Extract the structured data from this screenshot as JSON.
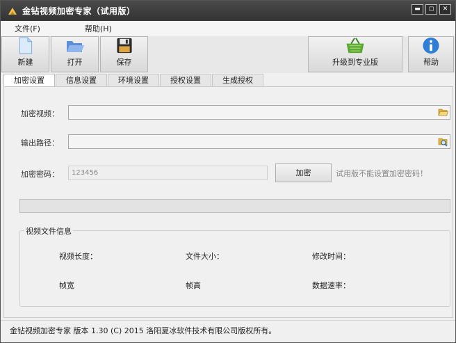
{
  "window": {
    "title": "金钻视频加密专家（试用版）",
    "controls": {
      "minimize": "▬",
      "maximize": "◻",
      "close": "✕"
    }
  },
  "menu": [
    {
      "label": "文件(F)"
    },
    {
      "label": "帮助(H)"
    }
  ],
  "toolbar": {
    "new_label": "新建",
    "open_label": "打开",
    "save_label": "保存",
    "upgrade_label": "升级到专业版",
    "help_label": "帮助"
  },
  "tabs": [
    {
      "label": "加密设置",
      "active": true
    },
    {
      "label": "信息设置"
    },
    {
      "label": "环境设置"
    },
    {
      "label": "授权设置"
    },
    {
      "label": "生成授权"
    }
  ],
  "form": {
    "video_label": "加密视频：",
    "video_value": "",
    "output_label": "输出路径：",
    "output_value": "",
    "password_label": "加密密码：",
    "password_value": "123456",
    "encrypt_button": "加密",
    "trial_note": "试用版不能设置加密密码！"
  },
  "progress": {
    "value": 0
  },
  "video_info": {
    "group_title": "视频文件信息",
    "duration_label": "视频长度：",
    "filesize_label": "文件大小：",
    "modified_label": "修改时间：",
    "width_label": "帧宽",
    "height_label": "帧高",
    "datarate_label": "数据速率："
  },
  "status": {
    "text": "金钻视频加密专家  版本 1.30 (C)  2015 洛阳夏冰软件技术有限公司版权所有。"
  },
  "colors": {
    "titlebar": "#3a3a3a",
    "window_bg": "#f0f0f0",
    "upgrade_icon": "#5aa832",
    "help_icon": "#2f7dd6",
    "folder_icon": "#5b8fd9"
  }
}
